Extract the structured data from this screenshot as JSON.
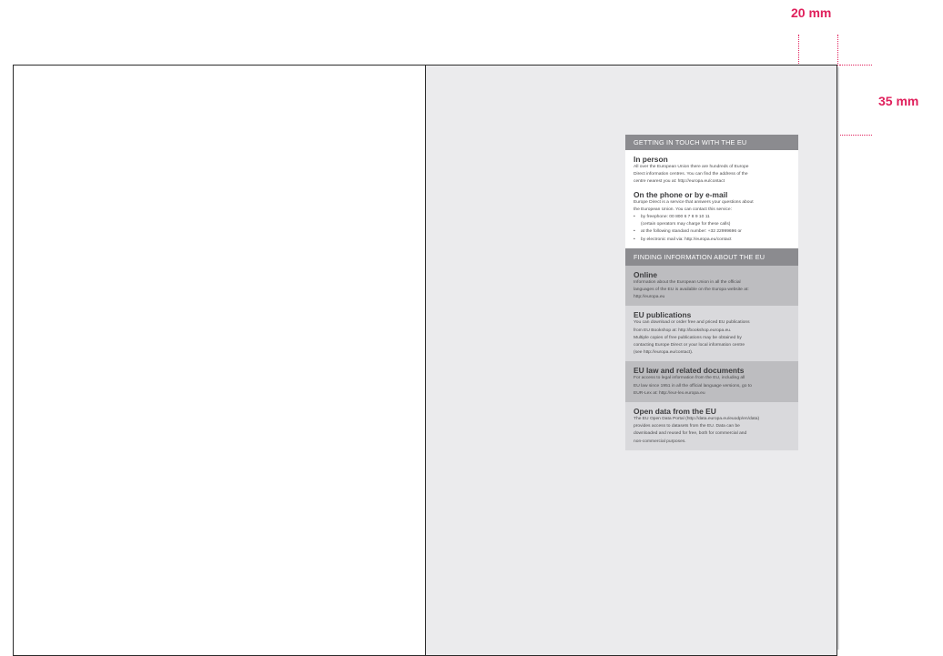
{
  "dimensions": {
    "horizontal": "20 mm",
    "vertical": "35 mm"
  },
  "colors": {
    "accent": "#e0205c",
    "header_bar": "#8b8b8f",
    "right_page_bg": "#ebebed"
  },
  "contact_box": {
    "title": "GETTING IN TOUCH WITH THE EU",
    "in_person": {
      "heading": "In person",
      "lines": [
        "All over the European Union there are hundreds of Europe",
        "Direct information centres. You can find the address of the",
        "centre nearest you at: http://europa.eu/contact"
      ]
    },
    "phone": {
      "heading": "On the phone or by e-mail",
      "lines": [
        "Europe Direct is a service that answers your questions about",
        "the European Union. You can contact this service:"
      ],
      "bullets": [
        "by freephone: 00 800 6 7 8 9 10 11",
        "(certain operators may charge for these calls)",
        "at the following standard number: +32 22999696 or",
        "by electronic mail via: http://europa.eu/contact"
      ]
    }
  },
  "info_box": {
    "title": "FINDING INFORMATION ABOUT THE EU",
    "online": {
      "heading": "Online",
      "lines": [
        "Information about the European Union in all the official",
        "languages of the EU is available on the Europa website at:",
        "http://europa.eu"
      ]
    },
    "publications": {
      "heading": "EU publications",
      "lines": [
        "You can download or order free and priced EU publications",
        "from EU Bookshop at: http://bookshop.europa.eu.",
        "Multiple copies of free publications may be obtained by",
        "contacting Europe Direct or your local information centre",
        "(see http://europa.eu/contact)."
      ]
    },
    "law": {
      "heading": "EU law and related documents",
      "lines": [
        "For access to legal information from the EU, including all",
        "EU law since 1951 in all the official language versions, go to",
        "EUR-Lex at: http://eur-lex.europa.eu"
      ]
    },
    "open_data": {
      "heading": "Open data from the EU",
      "lines": [
        "The EU Open Data Portal (http://data.europa.eu/euodp/en/data)",
        "provides access to datasets from the EU. Data can be",
        "downloaded and reused for free, both for commercial and",
        "non-commercial purposes."
      ]
    }
  }
}
